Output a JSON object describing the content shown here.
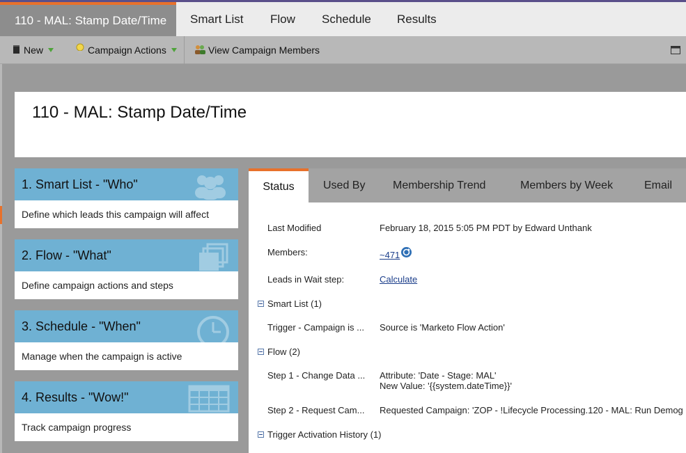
{
  "tabs": {
    "active": "110 - MAL: Stamp Date/Time",
    "items": [
      "Smart List",
      "Flow",
      "Schedule",
      "Results"
    ]
  },
  "toolbar": {
    "new_label": "New",
    "campaign_actions_label": "Campaign Actions",
    "view_members_label": "View Campaign Members"
  },
  "header": {
    "title": "110 - MAL: Stamp Date/Time"
  },
  "cards": [
    {
      "title": "1. Smart List - \"Who\"",
      "desc": "Define which leads this campaign will affect",
      "icon": "people-icon"
    },
    {
      "title": "2. Flow - \"What\"",
      "desc": "Define campaign actions and steps",
      "icon": "stack-icon"
    },
    {
      "title": "3. Schedule - \"When\"",
      "desc": "Manage when the campaign is active",
      "icon": "clock-icon"
    },
    {
      "title": "4. Results - \"Wow!\"",
      "desc": "Track campaign progress",
      "icon": "calendar-grid-icon"
    }
  ],
  "detail": {
    "tabs": [
      "Status",
      "Used By",
      "Membership Trend",
      "Members by Week",
      "Email"
    ],
    "last_modified_label": "Last Modified",
    "last_modified_value": "February 18, 2015 5:05 PM PDT by Edward Unthank",
    "members_label": "Members:",
    "members_value": "~471",
    "leads_wait_label": "Leads in Wait step:",
    "leads_wait_value": "Calculate",
    "smart_list_section": "Smart List (1)",
    "trigger_label": "Trigger - Campaign is ...",
    "trigger_value": "Source is 'Marketo Flow Action'",
    "flow_section": "Flow (2)",
    "step1_label": "Step 1 - Change Data ...",
    "step1_value_line1": "Attribute: 'Date - Stage: MAL'",
    "step1_value_line2": "New Value: '{{system.dateTime}}'",
    "step2_label": "Step 2 - Request Cam...",
    "step2_value": "Requested Campaign: 'ZOP - !Lifecycle Processing.120 - MAL: Run Demog",
    "trigger_history_section": "Trigger Activation History (1)"
  }
}
